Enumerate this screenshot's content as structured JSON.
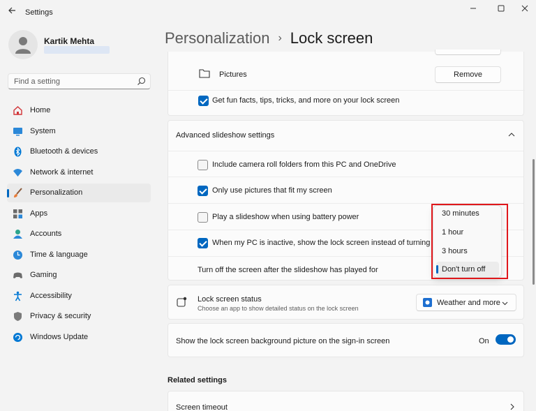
{
  "app": {
    "title": "Settings"
  },
  "user": {
    "name": "Kartik Mehta"
  },
  "search": {
    "placeholder": "Find a setting"
  },
  "nav": [
    {
      "label": "Home",
      "icon": "home-icon"
    },
    {
      "label": "System",
      "icon": "system-icon"
    },
    {
      "label": "Bluetooth & devices",
      "icon": "bluetooth-icon"
    },
    {
      "label": "Network & internet",
      "icon": "network-icon"
    },
    {
      "label": "Personalization",
      "icon": "brush-icon",
      "active": true
    },
    {
      "label": "Apps",
      "icon": "apps-icon"
    },
    {
      "label": "Accounts",
      "icon": "accounts-icon"
    },
    {
      "label": "Time & language",
      "icon": "time-language-icon"
    },
    {
      "label": "Gaming",
      "icon": "gaming-icon"
    },
    {
      "label": "Accessibility",
      "icon": "accessibility-icon"
    },
    {
      "label": "Privacy & security",
      "icon": "shield-icon"
    },
    {
      "label": "Windows Update",
      "icon": "update-icon"
    }
  ],
  "header": {
    "parent": "Personalization",
    "separator": "›",
    "current": "Lock screen"
  },
  "pictures": {
    "label": "Pictures",
    "remove_label": "Remove"
  },
  "fun_facts": {
    "label": "Get fun facts, tips, tricks, and more on your lock screen",
    "checked": true
  },
  "advanced": {
    "title": "Advanced slideshow settings",
    "options": [
      {
        "label": "Include camera roll folders from this PC and OneDrive",
        "checked": false
      },
      {
        "label": "Only use pictures that fit my screen",
        "checked": true
      },
      {
        "label": "Play a slideshow when using battery power",
        "checked": false
      },
      {
        "label": "When my PC is inactive, show the lock screen instead of turning off th",
        "checked": true
      }
    ],
    "turn_off_label": "Turn off the screen after the slideshow has played for"
  },
  "timeout_menu": {
    "options": [
      "30 minutes",
      "1 hour",
      "3 hours",
      "Don't turn off"
    ],
    "selected": "Don't turn off"
  },
  "lock_status": {
    "title": "Lock screen status",
    "subtitle": "Choose an app to show detailed status on the lock screen",
    "value": "Weather and more"
  },
  "signin_bg": {
    "label": "Show the lock screen background picture on the sign-in screen",
    "state": "On",
    "on": true
  },
  "related": {
    "heading": "Related settings",
    "screen_timeout": "Screen timeout"
  },
  "colors": {
    "accent": "#0067c0",
    "highlight": "#e0171b"
  }
}
